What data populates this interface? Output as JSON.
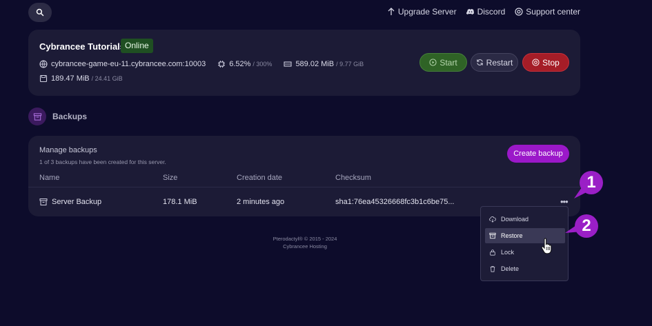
{
  "topnav": {
    "search_icon": "search-icon",
    "items": [
      {
        "label": "Upgrade Server",
        "icon": "arrow-up-icon"
      },
      {
        "label": "Discord",
        "icon": "discord-icon"
      },
      {
        "label": "Support center",
        "icon": "support-icon"
      }
    ]
  },
  "server": {
    "name": "Cybrancee Tutorials",
    "status": "Online",
    "address": "cybrancee-game-eu-11.cybrancee.com:10003",
    "cpu": "6.52%",
    "cpu_limit": "/ 300%",
    "memory": "589.02 MiB",
    "memory_limit": "/ 9.77 GiB",
    "disk": "189.47 MiB",
    "disk_limit": "/ 24.41 GiB",
    "buttons": {
      "start": "Start",
      "restart": "Restart",
      "stop": "Stop"
    }
  },
  "section": {
    "title": "Backups"
  },
  "backups": {
    "title": "Manage backups",
    "subtitle": "1 of 3 backups have been created for this server.",
    "create_label": "Create backup",
    "columns": [
      "Name",
      "Size",
      "Creation date",
      "Checksum"
    ],
    "rows": [
      {
        "name": "Server Backup",
        "size": "178.1 MiB",
        "created": "2 minutes ago",
        "checksum": "sha1:76ea45326668fc3b1c6be75..."
      }
    ],
    "more_label": "•••"
  },
  "menu": {
    "items": [
      {
        "label": "Download",
        "icon": "cloud-download-icon"
      },
      {
        "label": "Restore",
        "icon": "archive-icon"
      },
      {
        "label": "Lock",
        "icon": "lock-icon"
      },
      {
        "label": "Delete",
        "icon": "trash-icon"
      }
    ]
  },
  "footer": {
    "line1": "Pterodactyl® © 2015 - 2024",
    "line2": "Cybrancee Hosting"
  },
  "callouts": {
    "one": "1",
    "two": "2"
  },
  "colors": {
    "accent": "#9b18c9",
    "online": "#1f4f22",
    "stop": "#a51d27",
    "start": "#2f6326"
  }
}
